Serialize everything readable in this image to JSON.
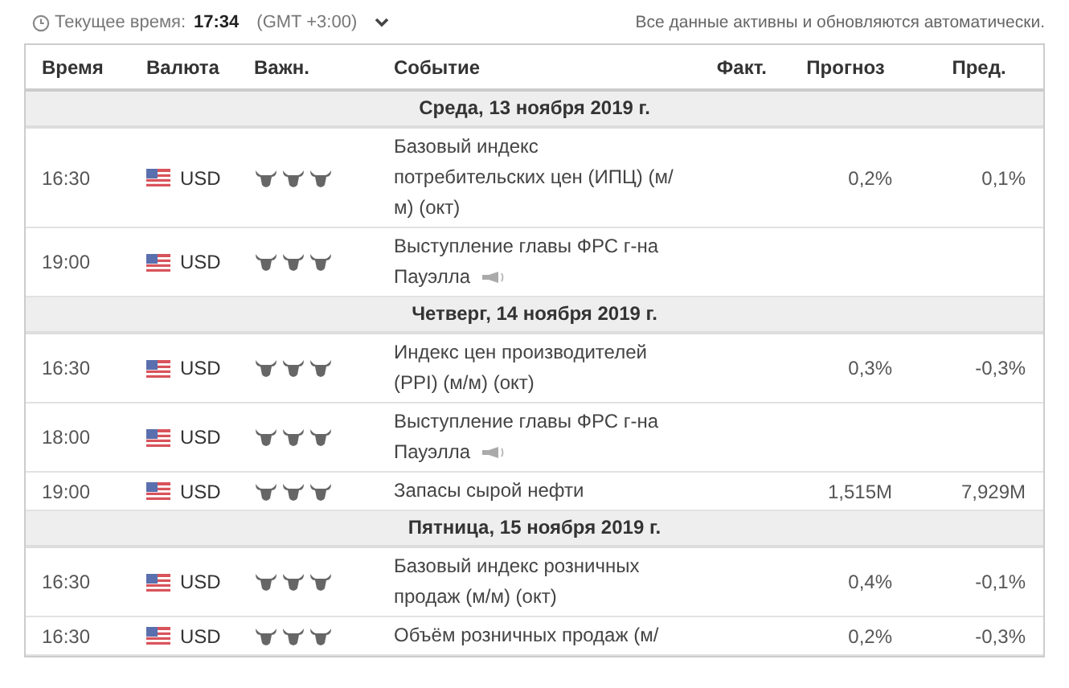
{
  "top_bar": {
    "label": "Текущее время:",
    "time": "17:34",
    "timezone": "(GMT +3:00)",
    "notice": "Все данные активны и обновляются автоматически."
  },
  "table": {
    "columns": [
      "Время",
      "Валюта",
      "Важн.",
      "Событие",
      "Факт.",
      "Прогноз",
      "Пред."
    ],
    "groups": [
      {
        "date": "Среда, 13 ноября 2019 г.",
        "rows": [
          {
            "time": "16:30",
            "currency": "USD",
            "stars": 3,
            "event": [
              "Базовый индекс",
              "потребительских цен (ИПЦ) (м/",
              "м) (окт)"
            ],
            "speech": false,
            "forecast": "0,2%",
            "previous": "0,1%"
          },
          {
            "time": "19:00",
            "currency": "USD",
            "stars": 3,
            "event": [
              "Выступление главы ФРС г-на",
              "Пауэлла"
            ],
            "speech": true
          }
        ]
      },
      {
        "date": "Четверг, 14 ноября 2019 г.",
        "rows": [
          {
            "time": "16:30",
            "currency": "USD",
            "stars": 3,
            "event": [
              "Индекс цен производителей",
              "(PPI) (м/м) (окт)"
            ],
            "speech": false,
            "forecast": "0,3%",
            "previous": "-0,3%"
          },
          {
            "time": "18:00",
            "currency": "USD",
            "stars": 3,
            "event": [
              "Выступление главы ФРС г-на",
              "Пауэлла"
            ],
            "speech": true
          },
          {
            "time": "19:00",
            "currency": "USD",
            "stars": 3,
            "event": [
              "Запасы сырой нефти"
            ],
            "speech": false,
            "forecast": "1,515M",
            "previous": "7,929M"
          }
        ]
      },
      {
        "date": "Пятница, 15 ноября 2019 г.",
        "rows": [
          {
            "time": "16:30",
            "currency": "USD",
            "stars": 3,
            "event": [
              "Базовый индекс розничных",
              "продаж (м/м) (окт)"
            ],
            "speech": false,
            "forecast": "0,4%",
            "previous": "-0,1%"
          },
          {
            "time": "16:30",
            "currency": "USD",
            "stars": 3,
            "event": [
              "Объём розничных продаж (м/"
            ],
            "speech": false,
            "forecast": "0,2%",
            "previous": "-0,3%"
          }
        ]
      }
    ]
  }
}
